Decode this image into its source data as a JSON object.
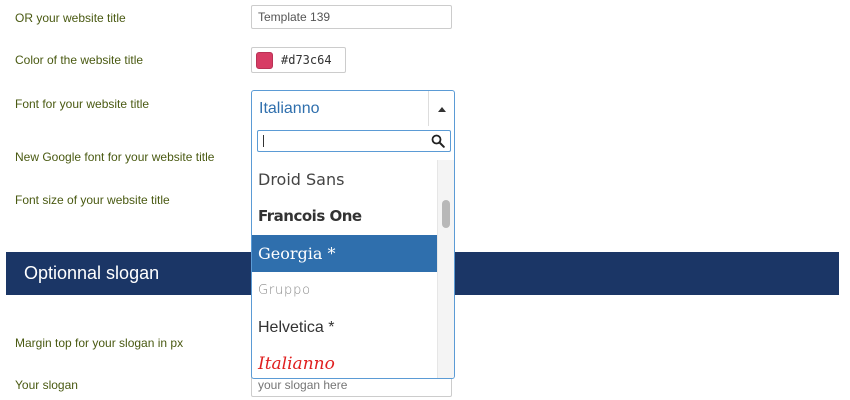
{
  "form": {
    "website_title_label": "OR your website title",
    "website_title_value": "Template 139",
    "title_color_label": "Color of the website title",
    "title_color_value": "#d73c64",
    "title_font_label": "Font for your website title",
    "google_font_label": "New Google font for your website title",
    "font_size_label": "Font size of your website title",
    "margin_top_label": "Margin top for your slogan in px",
    "slogan_label": "Your slogan",
    "slogan_placeholder": "your slogan here"
  },
  "font_select": {
    "selected_value": "Italianno",
    "search_value": "",
    "options": [
      {
        "label": "Droid Sans",
        "selected": false
      },
      {
        "label": "Francois One",
        "selected": false
      },
      {
        "label": "Georgia *",
        "selected": true
      },
      {
        "label": "Gruppo",
        "selected": false
      },
      {
        "label": "Helvetica *",
        "selected": false
      },
      {
        "label": "Italianno",
        "selected": false
      }
    ]
  },
  "section": {
    "title": "Optionnal slogan"
  },
  "colors": {
    "section_bar": "#1b3666",
    "label_text": "#4a5a12",
    "select_accent": "#5b9bd5",
    "selected_option_bg": "#2f6fad",
    "swatch": "#d73c64"
  },
  "icons": {
    "search": "search-icon",
    "dropdown_toggle": "chevron-up-icon"
  }
}
